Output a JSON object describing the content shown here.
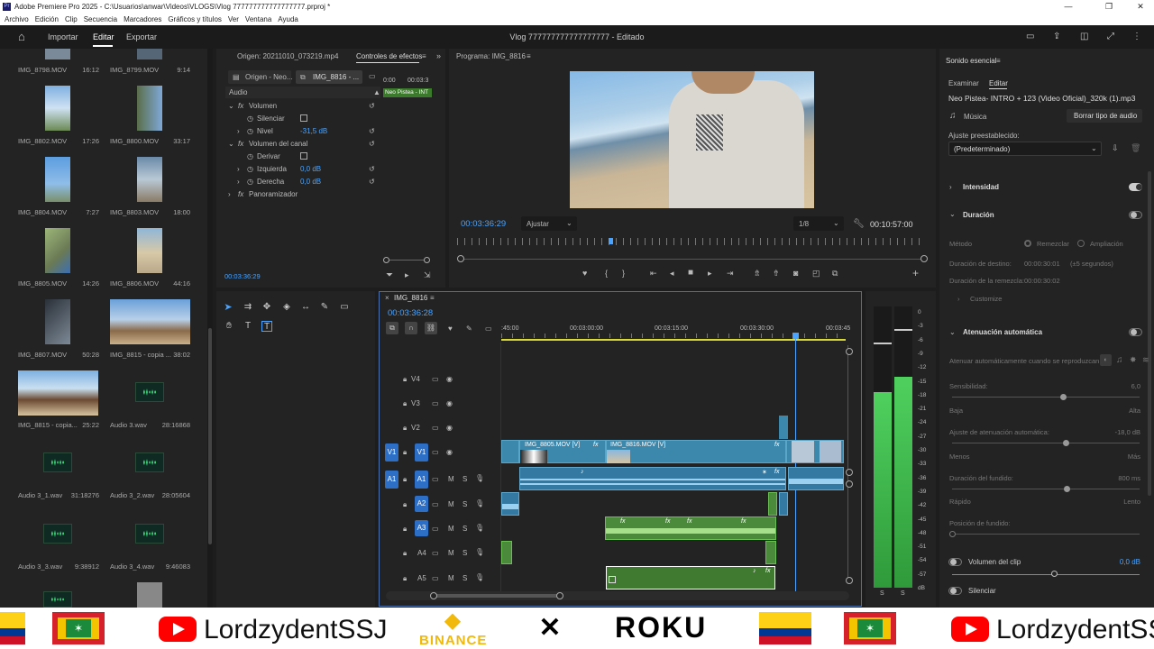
{
  "window": {
    "title": "Adobe Premiere Pro 2025 - C:\\Usuarios\\anwar\\Videos\\VLOGS\\Vlog 777777777777777777.prproj *",
    "menu": [
      "Archivo",
      "Edición",
      "Clip",
      "Secuencia",
      "Marcadores",
      "Gráficos y títulos",
      "Ver",
      "Ventana",
      "Ayuda"
    ]
  },
  "header": {
    "tabs": [
      "Importar",
      "Editar",
      "Exportar"
    ],
    "project_title": "Vlog 777777777777777777 - Editado"
  },
  "project": {
    "items": [
      {
        "name": "IMG_8798.MOV",
        "dur": "16:12"
      },
      {
        "name": "IMG_8799.MOV",
        "dur": "9:14"
      },
      {
        "name": "IMG_8802.MOV",
        "dur": "17:26"
      },
      {
        "name": "IMG_8800.MOV",
        "dur": "33:17"
      },
      {
        "name": "IMG_8804.MOV",
        "dur": "7:27"
      },
      {
        "name": "IMG_8803.MOV",
        "dur": "18:00"
      },
      {
        "name": "IMG_8805.MOV",
        "dur": "14:26"
      },
      {
        "name": "IMG_8806.MOV",
        "dur": "44:16"
      },
      {
        "name": "IMG_8807.MOV",
        "dur": "50:28"
      },
      {
        "name": "IMG_8815 - copia ...",
        "dur": "38:02"
      },
      {
        "name": "IMG_8815 - copia...",
        "dur": "25:22"
      },
      {
        "name": "Audio 3.wav",
        "dur": "28:16868"
      },
      {
        "name": "Audio 3_1.wav",
        "dur": "31:18276"
      },
      {
        "name": "Audio 3_2.wav",
        "dur": "28:05604"
      },
      {
        "name": "Audio 3_3.wav",
        "dur": "9:38912"
      },
      {
        "name": "Audio 3_4.wav",
        "dur": "9:46083"
      }
    ]
  },
  "effects": {
    "tab_origin": "Origen: 20211010_073219.mp4",
    "tab_controls": "Controles de efectos",
    "sub_origin": "Origen - Neo...",
    "sub_seq": "IMG_8816 - ...",
    "section": "Audio",
    "rows": [
      {
        "label": "Volumen",
        "value": ""
      },
      {
        "label": "Silenciar",
        "value": ""
      },
      {
        "label": "Nivel",
        "value": "-31,5 dB"
      },
      {
        "label": "Volumen del canal",
        "value": ""
      },
      {
        "label": "Derivar",
        "value": ""
      },
      {
        "label": "Izquierda",
        "value": "0,0 dB"
      },
      {
        "label": "Derecha",
        "value": "0,0 dB"
      },
      {
        "label": "Panoramizador",
        "value": ""
      }
    ],
    "mini_time_start": "0:00",
    "mini_time_end": "00:03:3",
    "mini_clip": "Neo Pistea - INT",
    "timecode": "00:03:36:29"
  },
  "program": {
    "title": "Programa: IMG_8816",
    "timecode": "00:03:36:29",
    "fit": "Ajustar",
    "quality": "1/8",
    "duration": "00:10:57:00"
  },
  "timeline": {
    "tab": "IMG_8816",
    "timecode": "00:03:36:28",
    "ruler": [
      ":45:00",
      "00:03:00:00",
      "00:03:15:00",
      "00:03:30:00",
      "00:03:45"
    ],
    "video_tracks": [
      "V4",
      "V3",
      "V2",
      "V1"
    ],
    "audio_tracks": [
      "A1",
      "A2",
      "A3",
      "A4",
      "A5"
    ],
    "clips": {
      "v1a": "IMG_8805.MOV [V]",
      "v1b": "IMG_8816.MOV [V]"
    },
    "meter_scale": [
      "0",
      "-3",
      "-6",
      "-9",
      "-12",
      "-15",
      "-18",
      "-21",
      "-24",
      "-27",
      "-30",
      "-33",
      "-36",
      "-39",
      "-42",
      "-45",
      "-48",
      "-51",
      "-54",
      "-57",
      "dB"
    ],
    "meter_solo": [
      "S",
      "S"
    ]
  },
  "essential_sound": {
    "title": "Sonido esencial",
    "tabs": [
      "Examinar",
      "Editar"
    ],
    "clip_name": "Neo Pistea- INTRO + 123 (Video Oficial)_320k (1).mp3",
    "type": "Música",
    "clear_type": "Borrar tipo de audio",
    "preset_label": "Ajuste preestablecido:",
    "preset_value": "(Predeterminado)",
    "sections": {
      "intensity": "Intensidad",
      "duration": "Duración",
      "method": "Método",
      "remix": "Remezclar",
      "stretch": "Ampliación",
      "target_dur": "Duración de destino:",
      "target_val": "00:00:30:01",
      "target_hint": "(±5 segundos)",
      "remix_dur": "Duración de la remezcla:",
      "remix_val": "00:00:30:02",
      "customize": "Customize",
      "ducking": "Atenuación automática",
      "duck_when": "Atenuar automáticamente cuando se reproduzcan:",
      "sensitivity": "Sensibilidad:",
      "sensitivity_val": "6,0",
      "low": "Baja",
      "high": "Alta",
      "duck_amount": "Ajuste de atenuación automática:",
      "duck_val": "-18,0 dB",
      "less": "Menos",
      "more": "Más",
      "fade_dur": "Duración del fundido:",
      "fade_val": "800 ms",
      "fast": "Rápido",
      "slow": "Lento",
      "fade_pos": "Posición de fundido:",
      "clip_vol": "Volumen del clip",
      "clip_vol_val": "0,0 dB",
      "mute": "Silenciar"
    }
  },
  "banner": {
    "channel1": "LordzydentSSJ",
    "binance": "BINANCE",
    "roku": "ROKU",
    "channel2": "LordzydentSSJ"
  },
  "colors": {
    "accent": "#2d6fc7",
    "timecode": "#4aa3ff",
    "audio_green": "#4a8a3a",
    "video_blue": "#3c88ad"
  }
}
